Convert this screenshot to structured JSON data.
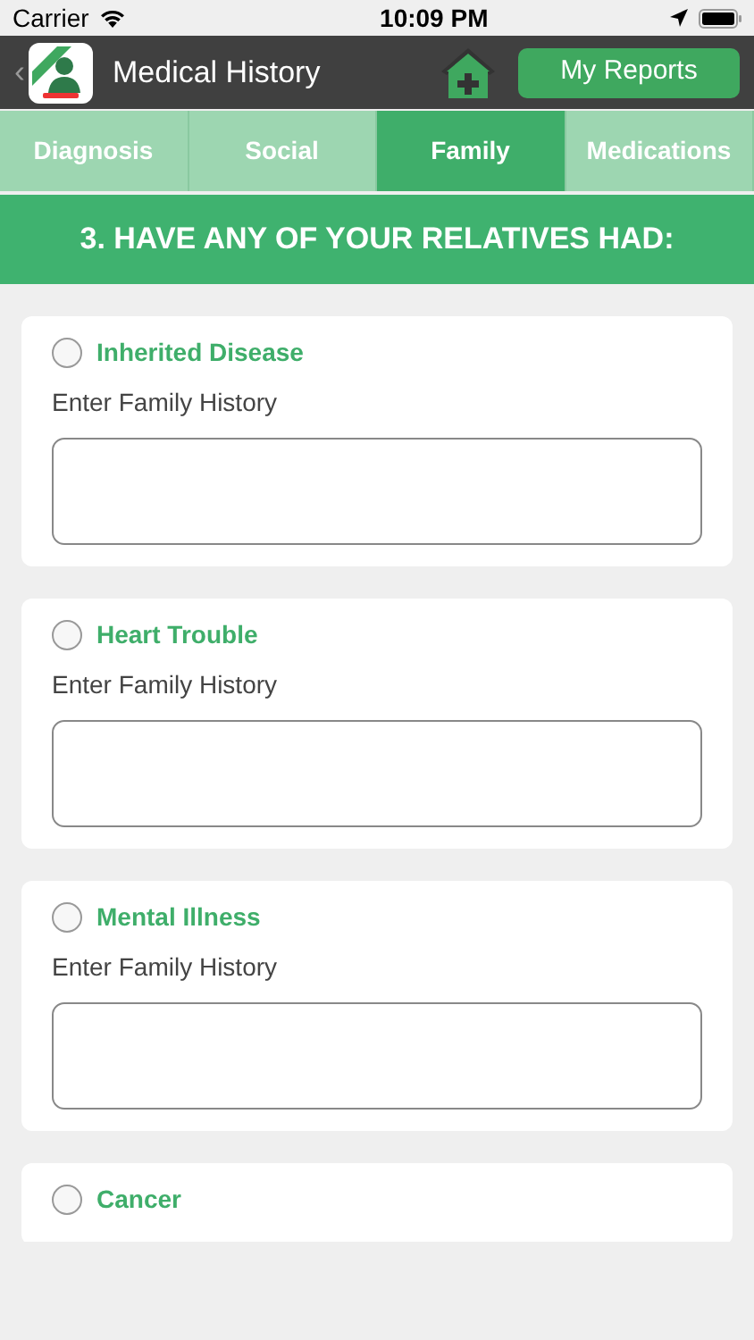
{
  "status_bar": {
    "carrier": "Carrier",
    "time": "10:09 PM"
  },
  "nav": {
    "back": "‹",
    "title": "Medical History",
    "button": "My Reports"
  },
  "tabs": [
    {
      "label": "Diagnosis",
      "selected": false
    },
    {
      "label": "Social",
      "selected": false
    },
    {
      "label": "Family",
      "selected": true
    },
    {
      "label": "Medications",
      "selected": false
    }
  ],
  "section_title": "3. HAVE ANY OF YOUR RELATIVES HAD:",
  "conditions": [
    {
      "label": "Inherited Disease",
      "checked": false,
      "prompt": "Enter Family History"
    },
    {
      "label": "Heart Trouble",
      "checked": false,
      "prompt": "Enter Family History"
    },
    {
      "label": "Mental Illness",
      "checked": false,
      "prompt": "Enter Family History"
    },
    {
      "label": "Cancer",
      "checked": false
    }
  ]
}
